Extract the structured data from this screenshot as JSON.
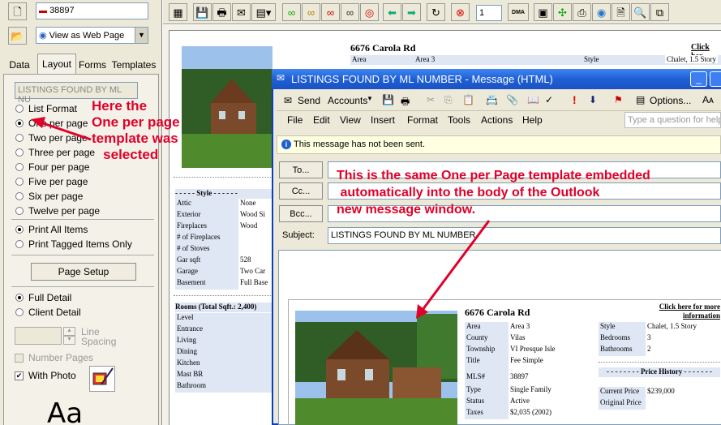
{
  "left_panel": {
    "mls_input": "38897",
    "view_dropdown": "View as Web Page",
    "tabs": [
      "Data",
      "Layout",
      "Forms",
      "Templates"
    ],
    "listing_field_placeholder": "LISTINGS FOUND BY ML NU",
    "format_options": [
      "List Format",
      "One per page",
      "Two per page",
      "Three per page",
      "Four per page",
      "Five per page",
      "Six per page",
      "Twelve per page"
    ],
    "print_options": [
      "Print All Items",
      "Print Tagged Items Only"
    ],
    "page_setup": "Page Setup",
    "detail_options": [
      "Full Detail",
      "Client Detail"
    ],
    "line_spacing": "Line Spacing",
    "number_pages": "Number Pages",
    "with_photo": "With Photo",
    "font_sample": "Aa"
  },
  "annotations": {
    "left": "Here the\nOne per page\ntemplate was\n   selected",
    "right": "This is the same One per Page template embedded\n automatically into the body of the Outlook\nnew message window."
  },
  "toolbar": {
    "page_value": "1",
    "dma_label": "DMA"
  },
  "background_listing": {
    "address": "6676 Carola Rd",
    "click_here": "Click her",
    "area_label": "Area",
    "area_value": "Area 3",
    "style_label": "Style",
    "style_value": "Chalet, 1.5 Story",
    "style_section": "Style",
    "style_rows": [
      [
        "Attic",
        "None"
      ],
      [
        "Exterior",
        "Wood Si"
      ],
      [
        "Fireplaces",
        "Wood"
      ],
      [
        "# of Fireplaces",
        ""
      ],
      [
        "# of Stoves",
        ""
      ],
      [
        "Gar sqft",
        "528"
      ],
      [
        "Garage",
        "Two Car"
      ],
      [
        "Basement",
        "Full Base"
      ]
    ],
    "rooms_header": "Rooms (Total Sqft.: 2,400)",
    "rooms": [
      "Level",
      "Entrance",
      "Living",
      "Dining",
      "Kitchen",
      "Mast BR",
      "Bathroom"
    ]
  },
  "outlook": {
    "title": "LISTINGS FOUND BY ML NUMBER - Message (HTML)",
    "toolbar": {
      "send": "Send",
      "accounts": "Accounts",
      "options": "Options..."
    },
    "menus": [
      "File",
      "Edit",
      "View",
      "Insert",
      "Format",
      "Tools",
      "Actions",
      "Help"
    ],
    "help_placeholder": "Type a question for help",
    "info_bar": "This message has not been sent.",
    "to_label": "To...",
    "cc_label": "Cc...",
    "bcc_label": "Bcc...",
    "subject_label": "Subject:",
    "subject_value": "LISTINGS FOUND BY ML NUMBER",
    "listing": {
      "address": "6676 Carola Rd",
      "click_here": "Click here for more information",
      "left_rows": [
        [
          "Area",
          "Area 3"
        ],
        [
          "County",
          "Vilas"
        ],
        [
          "Township",
          "VI Presque Isle"
        ],
        [
          "Title",
          "Fee Simple"
        ],
        [
          "MLS#",
          "38897"
        ],
        [
          "Type",
          "Single Family"
        ],
        [
          "Status",
          "Active"
        ],
        [
          "Taxes",
          "$2,035 (2002)"
        ]
      ],
      "right_rows": [
        [
          "Style",
          "Chalet, 1.5 Story"
        ],
        [
          "Bedrooms",
          "3"
        ],
        [
          "Bathrooms",
          "2"
        ]
      ],
      "price_history": "Price History",
      "price_rows": [
        [
          "Current Price",
          "$239,000"
        ],
        [
          "Original Price",
          ""
        ]
      ]
    }
  },
  "colors": {
    "annotation_red": "#e0002a",
    "xp_blue": "#1f5fd6",
    "label_bg": "#dfe6f4"
  }
}
